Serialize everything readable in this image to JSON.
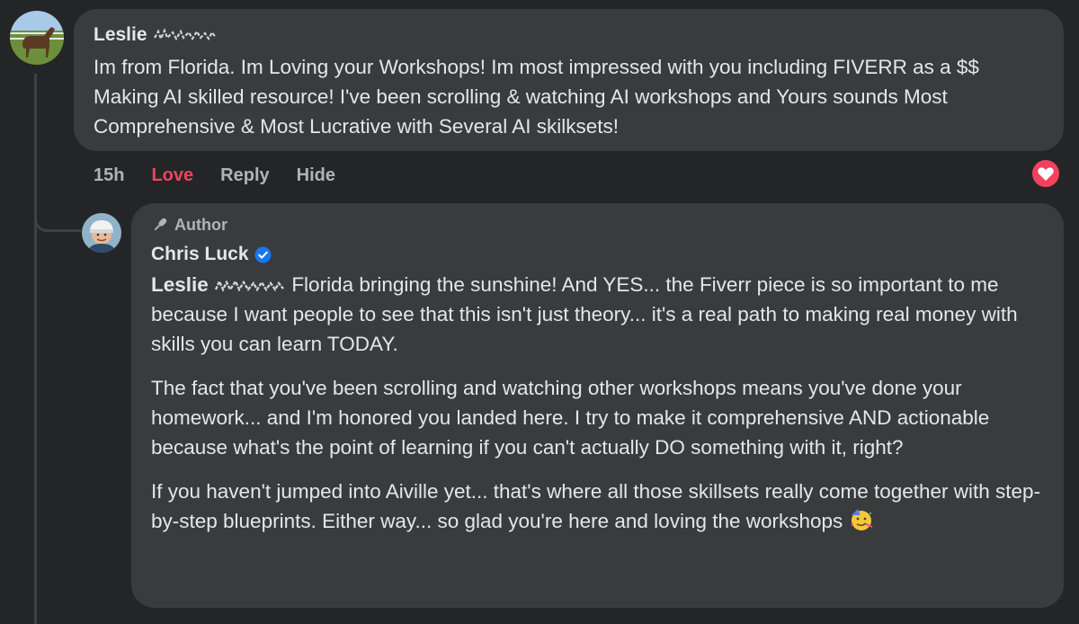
{
  "comment": {
    "author": "Leslie",
    "text": "Im from Florida. Im Loving your Workshops! Im most impressed with you including FIVERR as a $$ Making AI skilled resource! I've been scrolling & watching AI workshops and Yours sounds Most Comprehensive & Most Lucrative with Several AI skilksets!",
    "time": "15h",
    "actions": {
      "love": "Love",
      "reply": "Reply",
      "hide": "Hide"
    },
    "reaction_icon": "heart-icon",
    "reaction_color": "#f3425f"
  },
  "reply": {
    "badge": "Author",
    "badge_icon": "microphone-icon",
    "author": "Chris Luck",
    "verified_icon": "verified-badge-icon",
    "verified_color": "#1877f2",
    "mention": "Leslie",
    "paragraphs": [
      " Florida bringing the sunshine! And YES... the Fiverr piece is so important to me because I want people to see that this isn't just theory... it's a real path to making real money with skills you can learn TODAY.",
      "The fact that you've been scrolling and watching other workshops means you've done your homework... and I'm honored you landed here. I try to make it comprehensive AND actionable because what's the point of learning if you can't actually DO something with it, right?",
      "If you haven't jumped into Aiville yet... that's where all those skillsets really come together with step-by-step blueprints. Either way... so glad you're here and loving the workshops"
    ],
    "trailing_emoji": "partying-face-emoji"
  },
  "colors": {
    "background": "#242526",
    "bubble": "#3a3b3c",
    "text": "#e4e6eb",
    "secondary_text": "#b0b3b8",
    "love": "#f3425f"
  }
}
